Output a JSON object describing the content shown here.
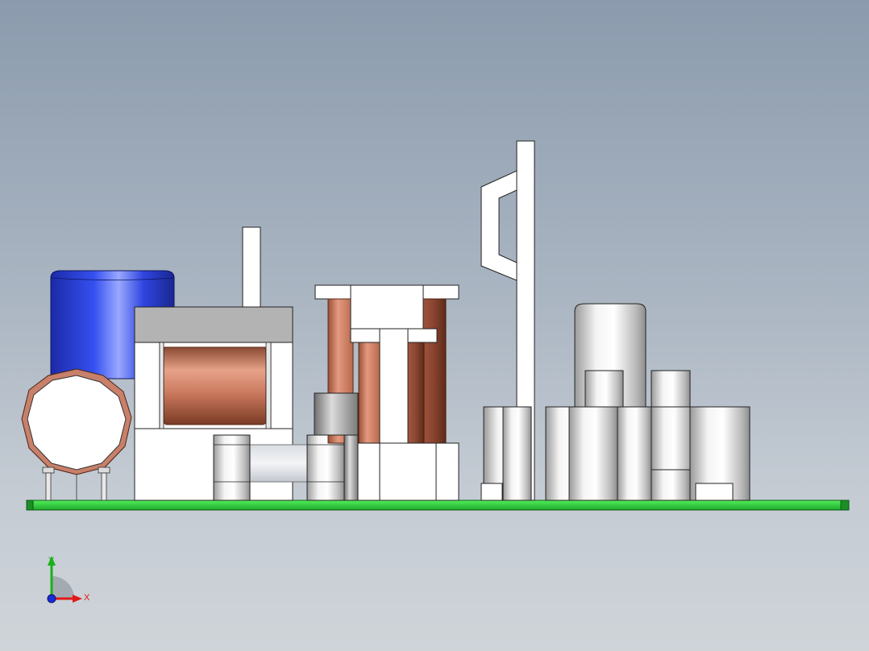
{
  "viewport": {
    "view": "Front",
    "background_top": "#8b9bad",
    "background_bottom": "#cfd4d9"
  },
  "triad": {
    "x_label": "X",
    "y_label": "Y",
    "x_color": "#e01818",
    "y_color": "#19b019",
    "z_color": "#1a2ad8"
  },
  "colors": {
    "pcb": "#2fd43b",
    "copper": "#c87a5c",
    "capacitor_blue": "#2a3fd8",
    "part_white": "#ffffff",
    "part_gray": "#b3b3b3"
  }
}
